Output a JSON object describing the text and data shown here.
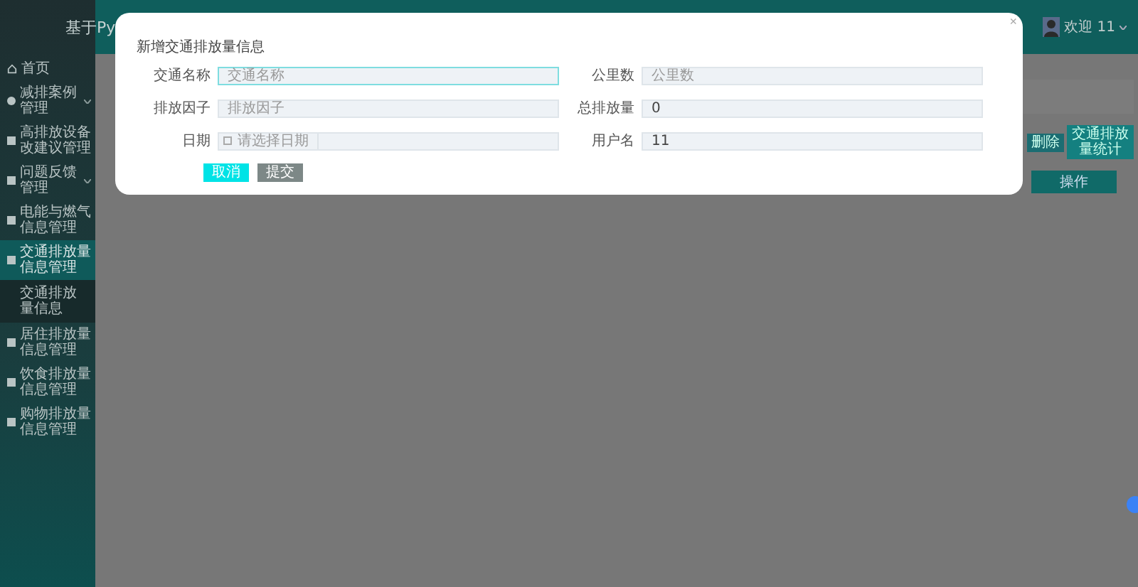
{
  "header": {
    "title": "基于Py",
    "user": "欢迎 11"
  },
  "sidebar": {
    "items": [
      {
        "label": "首页",
        "has_arrow": false,
        "selected": false
      },
      {
        "label": "减排案例管理",
        "has_arrow": true,
        "selected": false
      },
      {
        "label": "高排放设备改建议管理",
        "has_arrow": false,
        "selected": false
      },
      {
        "label": "问题反馈管理",
        "has_arrow": true,
        "selected": false
      },
      {
        "label": "电能与燃气信息管理",
        "has_arrow": false,
        "selected": false
      },
      {
        "label": "交通排放量信息管理",
        "has_arrow": false,
        "selected": true,
        "children": [
          {
            "label": "交通排放量信息",
            "selected": false
          }
        ]
      },
      {
        "label": "居住排放量信息管理",
        "has_arrow": false,
        "selected": false
      },
      {
        "label": "饮食排放量信息管理",
        "has_arrow": false,
        "selected": false
      },
      {
        "label": "购物排放量信息管理",
        "has_arrow": false,
        "selected": false
      }
    ]
  },
  "toolbar": {
    "buttons": [
      {
        "label": "删除"
      },
      {
        "label": "交通排放量统计"
      }
    ]
  },
  "table": {
    "columns": [
      "操作"
    ]
  },
  "dialog": {
    "title": "新增交通排放量信息",
    "close": "×",
    "fields": [
      {
        "label": "交通名称",
        "kind": "text",
        "placeholder": "交通名称",
        "focused": true
      },
      {
        "label": "公里数",
        "kind": "text",
        "placeholder": "公里数",
        "focused": false
      },
      {
        "label": "排放因子",
        "kind": "text",
        "placeholder": "排放因子",
        "focused": false
      },
      {
        "label": "总排放量",
        "kind": "text",
        "value": "0",
        "focused": false
      },
      {
        "label": "日期",
        "kind": "date",
        "placeholder": "请选择日期",
        "focused": false
      },
      {
        "label": "用户名",
        "kind": "text",
        "value": "11",
        "focused": false
      }
    ],
    "buttons": [
      {
        "label": "取消",
        "kind": "primary"
      },
      {
        "label": "提交",
        "kind": "secondary"
      }
    ]
  }
}
